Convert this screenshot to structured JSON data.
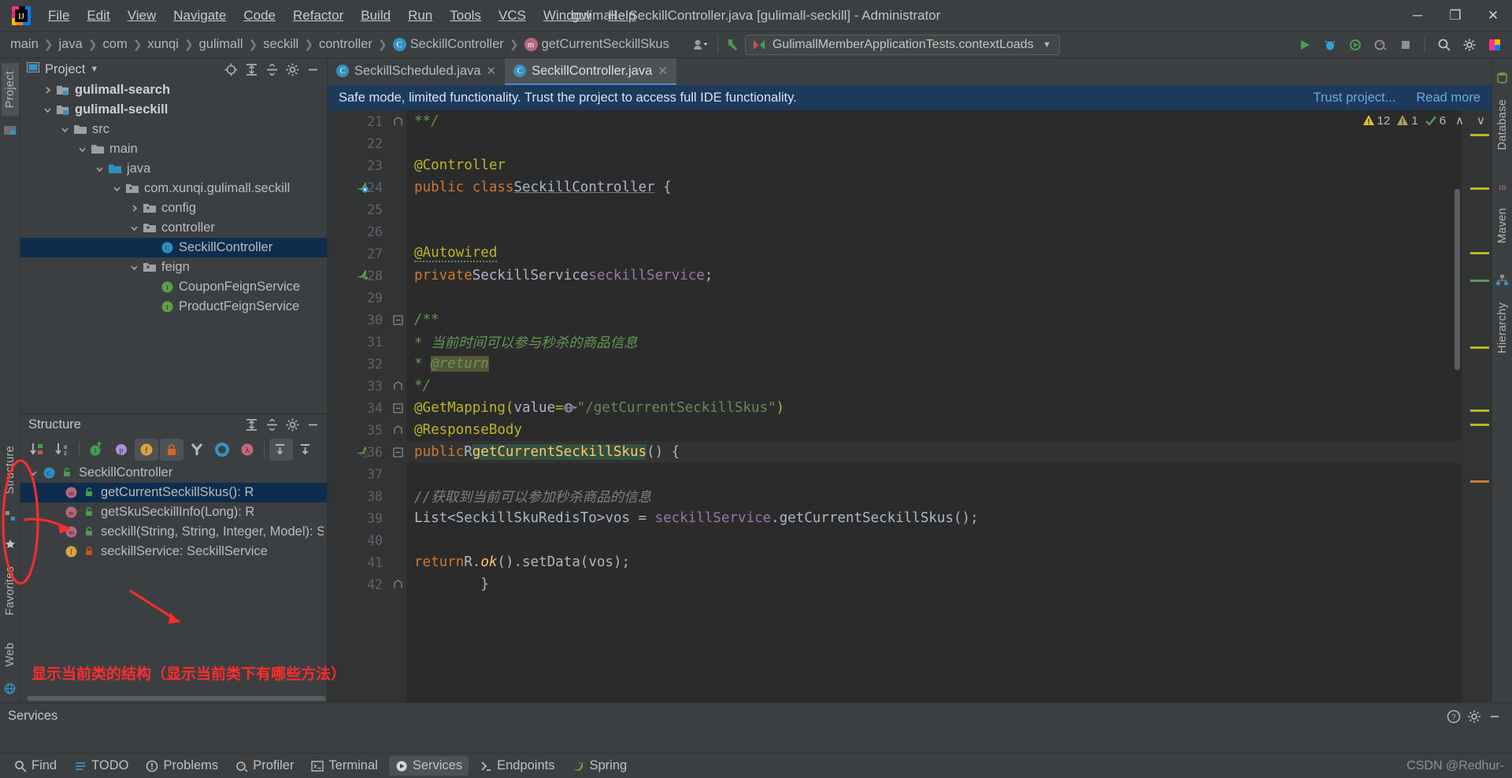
{
  "window": {
    "title": "gulimall - SeckillController.java [gulimall-seckill] - Administrator",
    "minimize": "─",
    "maximize": "❐",
    "close": "✕"
  },
  "menu": [
    "File",
    "Edit",
    "View",
    "Navigate",
    "Code",
    "Refactor",
    "Build",
    "Run",
    "Tools",
    "VCS",
    "Window",
    "Help"
  ],
  "breadcrumb": [
    {
      "label": "main",
      "icon": ""
    },
    {
      "label": "java",
      "icon": ""
    },
    {
      "label": "com",
      "icon": ""
    },
    {
      "label": "xunqi",
      "icon": ""
    },
    {
      "label": "gulimall",
      "icon": ""
    },
    {
      "label": "seckill",
      "icon": ""
    },
    {
      "label": "controller",
      "icon": ""
    },
    {
      "label": "SeckillController",
      "icon": "class-badge"
    },
    {
      "label": "getCurrentSeckillSkus",
      "icon": "method-badge"
    }
  ],
  "toolbar": {
    "run_config": "GulimallMemberApplicationTests.contextLoads",
    "icons": [
      "users-icon",
      "hammer-icon",
      "run-icon",
      "debug-icon",
      "run-coverage-icon",
      "profiler-icon",
      "stop-icon",
      "search-icon",
      "settings-icon",
      "updates-icon"
    ]
  },
  "left_strip": {
    "tabs": [
      "Project",
      "Structure",
      "Favorites",
      "Web"
    ],
    "active": "Project"
  },
  "right_strip": {
    "tabs": [
      "Database",
      "Maven",
      "Hierarchy"
    ]
  },
  "project_panel": {
    "title": "Project",
    "tree": [
      {
        "indent": 1,
        "arrow": "collapsed",
        "icon": "module-icon",
        "label": "gulimall-search",
        "bold": true,
        "selected": false
      },
      {
        "indent": 1,
        "arrow": "expanded",
        "icon": "module-icon",
        "label": "gulimall-seckill",
        "bold": true,
        "selected": false
      },
      {
        "indent": 2,
        "arrow": "expanded",
        "icon": "folder-icon",
        "label": "src",
        "bold": false,
        "selected": false
      },
      {
        "indent": 3,
        "arrow": "expanded",
        "icon": "folder-icon",
        "label": "main",
        "bold": false,
        "selected": false
      },
      {
        "indent": 4,
        "arrow": "expanded",
        "icon": "source-folder-icon",
        "label": "java",
        "bold": false,
        "selected": false
      },
      {
        "indent": 5,
        "arrow": "expanded",
        "icon": "package-icon",
        "label": "com.xunqi.gulimall.seckill",
        "bold": false,
        "selected": false
      },
      {
        "indent": 6,
        "arrow": "collapsed",
        "icon": "package-icon",
        "label": "config",
        "bold": false,
        "selected": false
      },
      {
        "indent": 6,
        "arrow": "expanded",
        "icon": "package-icon",
        "label": "controller",
        "bold": false,
        "selected": false
      },
      {
        "indent": 7,
        "arrow": "none",
        "icon": "class-icon",
        "label": "SeckillController",
        "bold": false,
        "selected": true
      },
      {
        "indent": 6,
        "arrow": "expanded",
        "icon": "package-icon",
        "label": "feign",
        "bold": false,
        "selected": false
      },
      {
        "indent": 7,
        "arrow": "none",
        "icon": "interface-icon",
        "label": "CouponFeignService",
        "bold": false,
        "selected": false
      },
      {
        "indent": 7,
        "arrow": "none",
        "icon": "interface-icon",
        "label": "ProductFeignService",
        "bold": false,
        "selected": false
      }
    ]
  },
  "structure_panel": {
    "title": "Structure",
    "toolbar_icons": [
      "sort-by-visibility-icon",
      "sort-alphabetically-icon",
      "show-inherited-icon",
      "show-properties-icon",
      "show-fields-icon",
      "show-non-public-icon",
      "show-anonymous-icon",
      "show-interfaces-icon",
      "show-lambdas-icon",
      "expand-all-icon",
      "collapse-all-icon"
    ],
    "tree": [
      {
        "indent": 0,
        "arrow": "expanded",
        "icon": "class-icon",
        "mod": "public-unlocked-icon",
        "label": "SeckillController",
        "selected": false
      },
      {
        "indent": 1,
        "arrow": "none",
        "icon": "method-icon",
        "mod": "public-unlocked-icon",
        "label": "getCurrentSeckillSkus(): R",
        "selected": true
      },
      {
        "indent": 1,
        "arrow": "none",
        "icon": "method-icon",
        "mod": "public-unlocked-icon",
        "label": "getSkuSeckillInfo(Long): R",
        "selected": false
      },
      {
        "indent": 1,
        "arrow": "none",
        "icon": "method-icon",
        "mod": "public-unlocked-icon",
        "label": "seckill(String, String, Integer, Model): Strin",
        "selected": false
      },
      {
        "indent": 1,
        "arrow": "none",
        "icon": "field-icon",
        "mod": "private-locked-icon",
        "label": "seckillService: SeckillService",
        "selected": false
      }
    ]
  },
  "annotation": {
    "text": "显示当前类的结构（显示当前类下有哪些方法）",
    "color": "#ff2d2d"
  },
  "editor": {
    "tabs": [
      {
        "label": "SeckillScheduled.java",
        "icon": "class-icon",
        "active": false,
        "close": "✕"
      },
      {
        "label": "SeckillController.java",
        "icon": "class-icon",
        "active": true,
        "close": "✕"
      }
    ],
    "notification": {
      "message": "Safe mode, limited functionality. Trust the project to access full IDE functionality.",
      "links": [
        "Trust project...",
        "Read more"
      ]
    },
    "inspection": {
      "warnings": "12",
      "weak_warnings": "1",
      "checks": "6",
      "up": "∧",
      "down": "∨"
    },
    "lines": [
      {
        "n": "21",
        "fold": "end",
        "html": "    <span class='cmt'>**/</span>"
      },
      {
        "n": "22",
        "fold": "",
        "html": ""
      },
      {
        "n": "23",
        "fold": "",
        "html": "    <span class='ann'>@Controller</span>"
      },
      {
        "n": "24",
        "fold": "",
        "gutter_icon": "bean-icon",
        "html": "    <span class='kw'>public class</span> <span class='cls'>SeckillController</span> {"
      },
      {
        "n": "25",
        "fold": "",
        "html": ""
      },
      {
        "n": "26",
        "fold": "",
        "html": ""
      },
      {
        "n": "27",
        "fold": "",
        "html": "        <span class='ann wavy'>@Autowired</span>"
      },
      {
        "n": "28",
        "fold": "",
        "gutter_icon": "navigate-bean-icon",
        "html": "        <span class='kw'>private</span> <span class='typ'>SeckillService</span> <span class='fld'>seckillService</span>;"
      },
      {
        "n": "29",
        "fold": "",
        "html": ""
      },
      {
        "n": "30",
        "fold": "start",
        "html": "        <span class='cmt'>/**</span>"
      },
      {
        "n": "31",
        "fold": "",
        "html": "         <span class='cmt'>* 当前时间可以参与秒杀的商品信息</span>"
      },
      {
        "n": "32",
        "fold": "",
        "html": "         <span class='cmt'>* </span><span class='cmt tag-hl'>@return</span>"
      },
      {
        "n": "33",
        "fold": "end",
        "html": "         <span class='cmt'>*/</span>"
      },
      {
        "n": "34",
        "fold": "mid",
        "html": "        <span class='ann'>@GetMapping(</span><span class='typ'>value</span> <span class='ann'>=</span> <span class='web-ico'></span><span class='str'>\"/getCurrentSeckillSkus\"</span><span class='ann'>)</span>"
      },
      {
        "n": "35",
        "fold": "end",
        "html": "        <span class='ann'>@ResponseBody</span>"
      },
      {
        "n": "36",
        "fold": "mid",
        "current": true,
        "gutter_icon": "url-mapping-icon",
        "html": "        <span class='kw'>public</span> <span class='typ'>R</span> <span class='caret'></span><span class='mth sel-tok'>getCurrentSeckillSkus</span>() {"
      },
      {
        "n": "37",
        "fold": "",
        "html": ""
      },
      {
        "n": "38",
        "fold": "",
        "html": "            <span class='cmt2'>//获取到当前可以参加秒杀商品的信息</span>"
      },
      {
        "n": "39",
        "fold": "",
        "html": "            <span class='typ'>List&lt;SeckillSkuRedisTo&gt;</span> <span class='typ'>vos</span> = <span class='fld'>seckillService</span>.<span class='typ'>getCurrentSeckillSkus</span>();"
      },
      {
        "n": "40",
        "fold": "",
        "html": ""
      },
      {
        "n": "41",
        "fold": "",
        "html": "            <span class='kw'>return</span> <span class='typ'>R</span>.<span class='mth' style='font-style:italic'>ok</span>().<span class='typ'>setData</span>(<span class='typ'>vos</span>);"
      },
      {
        "n": "42",
        "fold": "end",
        "html": "        }"
      }
    ]
  },
  "services": {
    "title": "Services",
    "actions": [
      "help-icon",
      "settings-icon",
      "hide-icon"
    ]
  },
  "statusbar": {
    "items": [
      {
        "label": "Find",
        "icon": "search-icon",
        "active": false
      },
      {
        "label": "TODO",
        "icon": "todo-icon",
        "active": false
      },
      {
        "label": "Problems",
        "icon": "problems-icon",
        "active": false
      },
      {
        "label": "Profiler",
        "icon": "profiler-icon",
        "active": false
      },
      {
        "label": "Terminal",
        "icon": "terminal-icon",
        "active": false
      },
      {
        "label": "Services",
        "icon": "services-icon",
        "active": true
      },
      {
        "label": "Endpoints",
        "icon": "endpoints-icon",
        "active": false
      },
      {
        "label": "Spring",
        "icon": "spring-icon",
        "active": false
      }
    ],
    "watermark": "CSDN @Redhur-"
  }
}
